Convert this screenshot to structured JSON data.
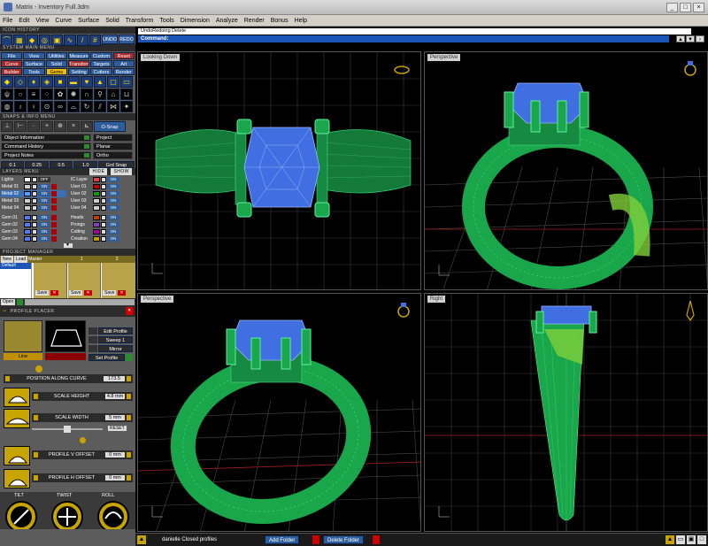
{
  "window": {
    "title": "Matrix - Inventory Full.3dm"
  },
  "menubar": [
    "File",
    "Edit",
    "View",
    "Curve",
    "Surface",
    "Solid",
    "Transform",
    "Tools",
    "Dimension",
    "Analyze",
    "Render",
    "Bonus",
    "Help"
  ],
  "sections": {
    "icon_history": "ICON HISTORY",
    "system_main": "SYSTEM MAIN MENU",
    "snaps": "SNAPS & INFO MENU",
    "layers": "LAYERS MENU",
    "project_manager": "PROJECT MANAGER",
    "profile_placer": "PROFILE PLACER"
  },
  "toolbar_top": {
    "undo": "UNDO",
    "redo": "REDO"
  },
  "main_menu": {
    "row1": [
      "File",
      "View",
      "Utilities",
      "Measure",
      "Custom",
      "Reset"
    ],
    "row2": [
      "Curve",
      "Surface",
      "Solid",
      "Transform",
      "Targets",
      "Art"
    ],
    "row3": [
      "Builder",
      "Tools",
      "Gems",
      "Setting",
      "Cutters",
      "Render"
    ]
  },
  "snaps": {
    "osnap": "O-Snap",
    "info_buttons": [
      "Object Information",
      "Command History",
      "Project Notes"
    ],
    "right_buttons": [
      "Project",
      "Planar",
      "Ortho"
    ],
    "grid_values": [
      "0.1",
      "0.25",
      "0.5",
      "1.0"
    ],
    "grid_snap": "Grd Snap"
  },
  "layers": {
    "hide": "HIDE",
    "show": "SHOW",
    "lights": "Lights",
    "off": "OFF",
    "ic_layer": "IC Layer",
    "on": "ON",
    "left": [
      "Metal 01",
      "Metal 02",
      "Metal 03",
      "Metal 04",
      "Gem 01",
      "Gem 02",
      "Gem 03",
      "Gem 04"
    ],
    "left_colors": [
      "#d0d0d0",
      "#4aa3ff",
      "#d0d0d0",
      "#d0d0d0",
      "#4a7dff",
      "#4a7dff",
      "#4a7dff",
      "#4a7dff"
    ],
    "right": [
      "User 01",
      "User 02",
      "User 03",
      "User 04",
      "Heads",
      "Prongs",
      "Cutting",
      "Creation"
    ],
    "right_colors": [
      "#c00000",
      "#00a000",
      "#d0d0d0",
      "#d0d0d0",
      "#c04000",
      "#8040c0",
      "#a000a0",
      "#c0a000"
    ]
  },
  "project_manager": {
    "new": "New",
    "load": "Load",
    "master": "Master",
    "col1": "1",
    "col2": "2",
    "default": "Default",
    "save": "Save",
    "open": "Open"
  },
  "profile_placer": {
    "line": "Line",
    "edit_profile": "Edit Profile",
    "sweep": "Sweep 1",
    "mirror": "Mirror",
    "set_profile": "Set Profile",
    "position_label": "POSITION ALONG CURVE",
    "position_value": "173.5",
    "scale_height": "SCALE HEIGHT",
    "scale_height_value": "4.8 mm",
    "scale_width": "SCALE WIDTH",
    "scale_width_value": "5 mm",
    "reset": "RESET",
    "v_offset": "PROFILE V OFFSET",
    "v_offset_value": "0 mm",
    "h_offset": "PROFILE H OFFSET",
    "h_offset_value": "0 mm",
    "tilt": "TILT",
    "twist": "TWIST",
    "roll": "ROLL"
  },
  "command": {
    "undo_line": "UndoRedoing Delete",
    "label": "Command:"
  },
  "viewports": {
    "tl": "Looking Down",
    "tr": "Perspective",
    "bl": "Perspective",
    "br": "Right"
  },
  "status": {
    "text": "danielle Closed profiles",
    "add_folder": "Add Folder",
    "delete_folder": "Delete Folder"
  },
  "colors": {
    "metal": "#1aa64a",
    "gem": "#3f6fe0",
    "grid": "#5a5a5a",
    "panel": "#5c5c5c",
    "accent_blue": "#2f5d9a"
  }
}
